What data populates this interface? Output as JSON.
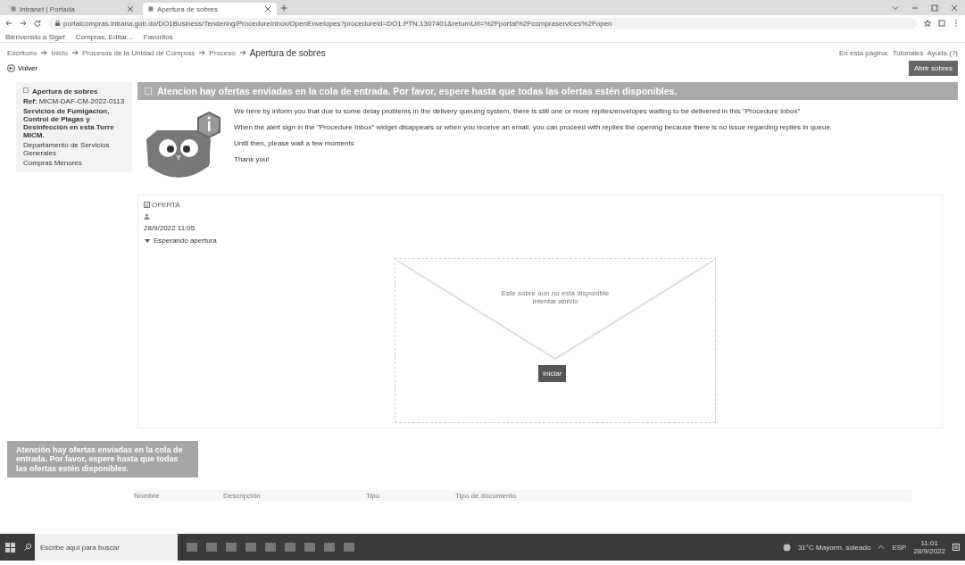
{
  "browser": {
    "tabs": [
      {
        "label": "Intranet | Portada",
        "selected": false
      },
      {
        "label": "Apertura de sobres",
        "selected": true
      }
    ],
    "url": "portalcompras.intrana.gob.do/DO1Business/Tendering/ProcedureInbox/OpenEnvelopes?procedureId=DO1.PTN.1307401&returnUrl=%2Fportal%2Fcompraservices%2Fopen",
    "bookmarks": [
      "Bienvenido a Sigef",
      "Compras, Editar...",
      "Favoritos"
    ]
  },
  "breadcrumb": [
    "Escritorio",
    "Inicio",
    "Procesos de la Unidad de Compras",
    "Proceso",
    "Apertura de sobres"
  ],
  "page_links": {
    "label": "En esta página:",
    "items": [
      "Tutoriales",
      "Ayuda (?)"
    ]
  },
  "back_button": "Volver",
  "open_button": "Abrir sobres",
  "sidebar": {
    "title": "Apertura de sobres",
    "ref_label": "Ref:",
    "ref": "MICM-DAF-CM-2022-0113",
    "description": "Servicios de Fumigacion, Control de Plagas y Desinfección en esta Torre MICM.",
    "department": "Departamento de Servicios Generales",
    "modality": "Compras Menores"
  },
  "alert": {
    "title": "Atencion hay ofertas enviadas en la cola de entrada. Por favor, espere hasta que todas las ofertas estén disponibles.",
    "paragraphs": [
      "We here by inform you that due to some delay problems in the delivery queuing system, there is still one or more replies/envelopes waiting to be delivered in this \"Procedure Inbox\"",
      "When the alert sign in the \"Procedure Inbox\" widget disappears or when you receive an email, you can proceed with replies the opening because there is no issue regarding replies in queue.",
      "Until then, please wait a few moments",
      "Thank you!"
    ]
  },
  "offer": {
    "title": "OFERTA",
    "date": "28/9/2022 11:05",
    "status": "Esperando apertura",
    "envelope_text": [
      "Este sobre aún no está disponible",
      "Intentar abrirlo"
    ],
    "start_button": "Iniciar"
  },
  "toast": "Atención hay ofertas enviadas en la cola de entrada. Por favor, espere hasta que todas las ofertas estén disponibles.",
  "table": {
    "columns": [
      "Nombre",
      "Descripción",
      "Tipo",
      "Tipo de documento"
    ]
  },
  "taskbar": {
    "search_placeholder": "Escribe aquí para buscar",
    "weather": "31°C Mayorm. soleado",
    "language": "ESP",
    "time": "11:01",
    "date": "28/9/2022"
  }
}
